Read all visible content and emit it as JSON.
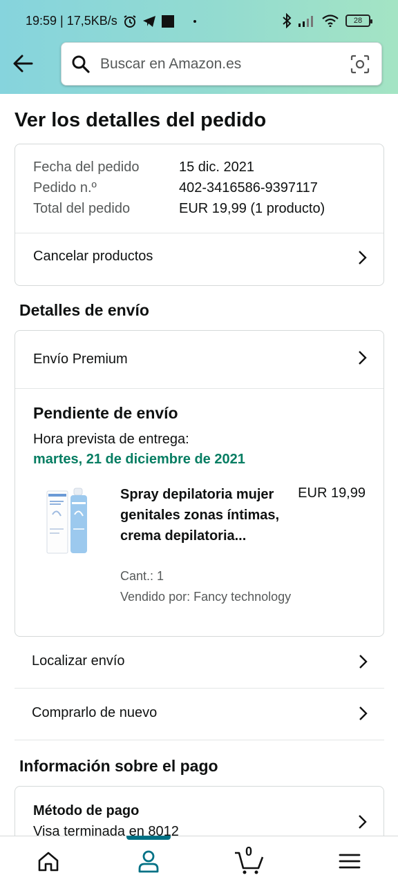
{
  "status_bar": {
    "time_info": "19:59 | 17,5KB/s",
    "battery": "28"
  },
  "search": {
    "placeholder": "Buscar en Amazon.es"
  },
  "page": {
    "title": "Ver los detalles del pedido"
  },
  "order_summary": {
    "rows": [
      {
        "label": "Fecha del pedido",
        "value": "15 dic. 2021"
      },
      {
        "label": "Pedido n.º",
        "value": "402-3416586-9397117"
      },
      {
        "label": "Total del pedido",
        "value": "EUR 19,99 (1 producto)"
      }
    ],
    "cancel_label": "Cancelar productos"
  },
  "shipping": {
    "section_title": "Detalles de envío",
    "premium_label": "Envío Premium",
    "status": "Pendiente de envío",
    "eta_label": "Hora prevista de entrega:",
    "eta_date": "martes, 21 de diciembre de 2021",
    "product": {
      "title": "Spray depilatoria mujer genitales zonas íntimas, crema depilatoria...",
      "price": "EUR 19,99",
      "quantity": "Cant.: 1",
      "seller": "Vendido por: Fancy technology"
    },
    "track_label": "Localizar envío",
    "buy_again_label": "Comprarlo de nuevo"
  },
  "payment": {
    "section_title": "Información sobre el pago",
    "method_title": "Método de pago",
    "method_value": "Visa terminada en 8012"
  },
  "bottom_nav": {
    "cart_count": "0",
    "active": "account"
  },
  "colors": {
    "header_gradient_start": "#86d4dd",
    "header_gradient_end": "#a4e4c4",
    "eta_green": "#067d62",
    "nav_accent": "#007185"
  }
}
